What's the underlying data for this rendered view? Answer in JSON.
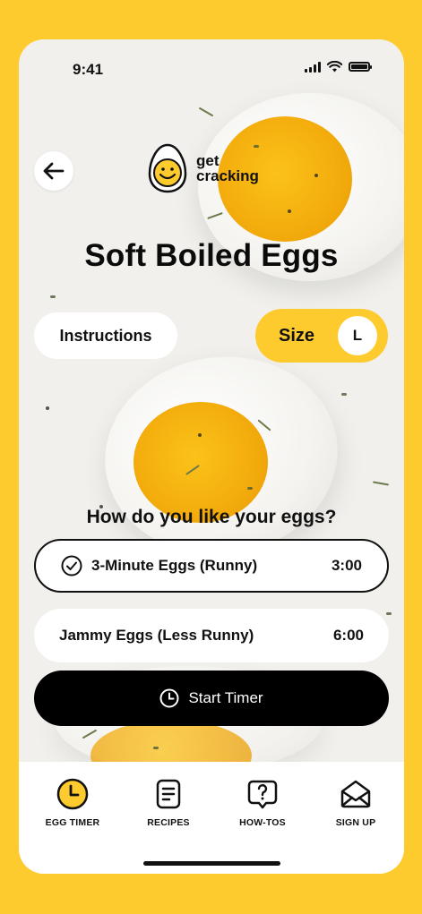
{
  "status": {
    "time": "9:41"
  },
  "header": {
    "logo_line1": "get",
    "logo_line2": "cracking"
  },
  "page": {
    "title": "Soft Boiled Eggs"
  },
  "controls": {
    "instructions_label": "Instructions",
    "size_label": "Size",
    "size_value": "L"
  },
  "question": "How do you like your eggs?",
  "options": [
    {
      "label": "3-Minute Eggs (Runny)",
      "time": "3:00",
      "selected": true
    },
    {
      "label": "Jammy Eggs (Less Runny)",
      "time": "6:00",
      "selected": false
    }
  ],
  "start_button": {
    "label": "Start Timer",
    "icon": "clock-icon"
  },
  "tabbar": [
    {
      "label": "EGG TIMER",
      "icon": "clock-icon"
    },
    {
      "label": "RECIPES",
      "icon": "recipe-icon"
    },
    {
      "label": "HOW-TOS",
      "icon": "help-icon"
    },
    {
      "label": "SIGN UP",
      "icon": "mail-icon"
    }
  ],
  "colors": {
    "accent": "#FDCB2E",
    "button_dark": "#000000",
    "surface": "#FFFFFF"
  }
}
